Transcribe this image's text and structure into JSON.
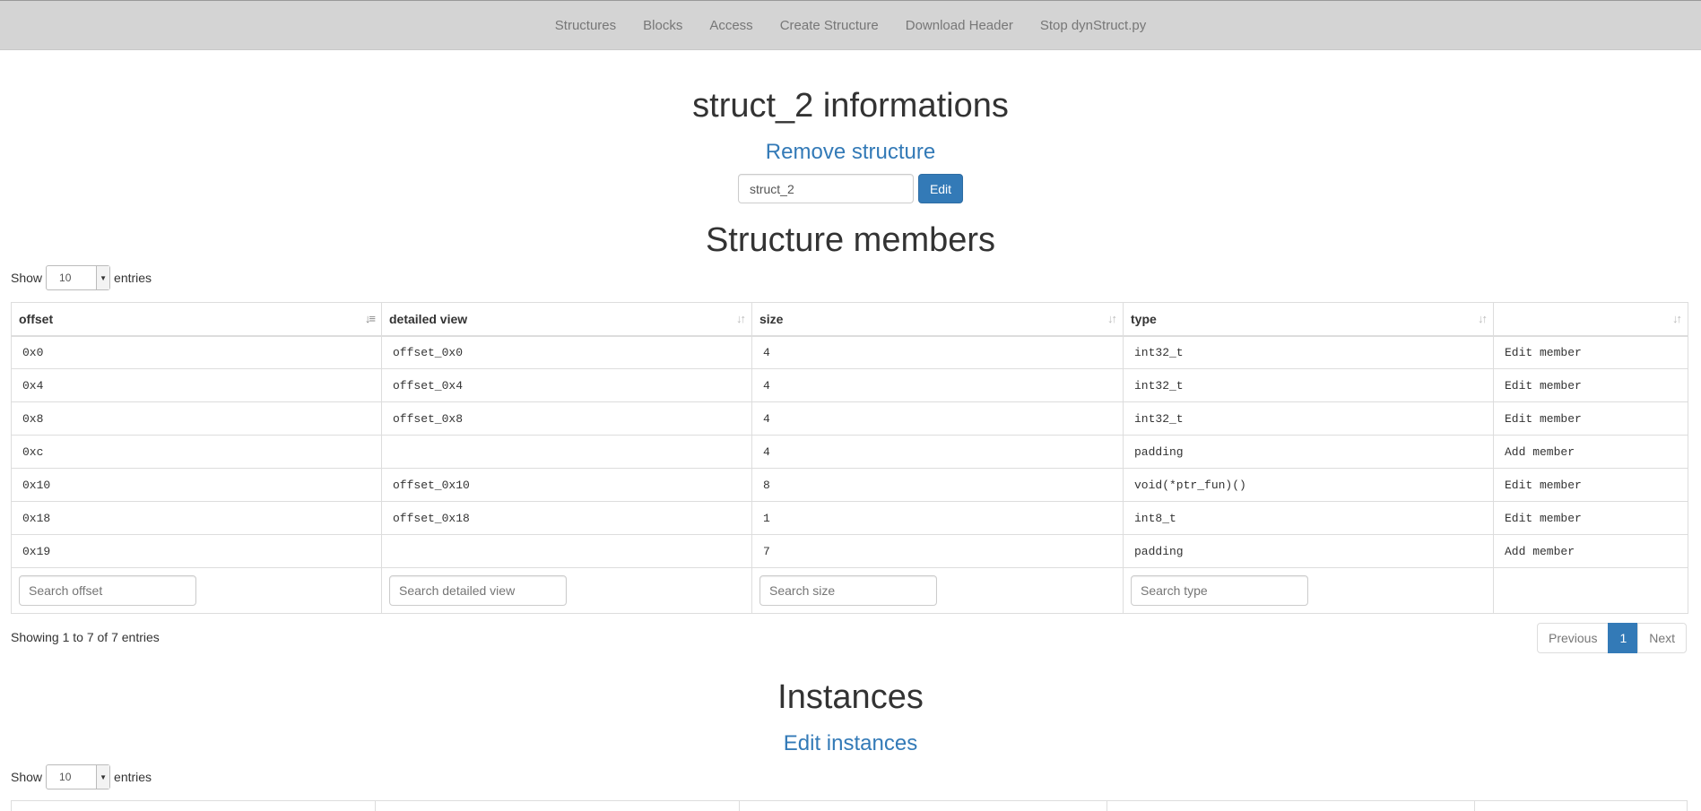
{
  "nav": {
    "items": [
      "Structures",
      "Blocks",
      "Access",
      "Create Structure",
      "Download Header",
      "Stop dynStruct.py"
    ]
  },
  "header": {
    "title": "struct_2 informations",
    "remove_link": "Remove structure",
    "name_value": "struct_2",
    "edit_button": "Edit"
  },
  "members": {
    "title": "Structure members",
    "show_label": "Show",
    "page_size": "10",
    "entries_label": "entries",
    "columns": [
      "offset",
      "detailed view",
      "size",
      "type",
      ""
    ],
    "rows": [
      {
        "offset": "0x0",
        "detail": "offset_0x0",
        "size": "4",
        "type": "int32_t",
        "action": "Edit member"
      },
      {
        "offset": "0x4",
        "detail": "offset_0x4",
        "size": "4",
        "type": "int32_t",
        "action": "Edit member"
      },
      {
        "offset": "0x8",
        "detail": "offset_0x8",
        "size": "4",
        "type": "int32_t",
        "action": "Edit member"
      },
      {
        "offset": "0xc",
        "detail": "",
        "size": "4",
        "type": "padding",
        "action": "Add member"
      },
      {
        "offset": "0x10",
        "detail": "offset_0x10",
        "size": "8",
        "type": "void(*ptr_fun)()",
        "action": "Edit member"
      },
      {
        "offset": "0x18",
        "detail": "offset_0x18",
        "size": "1",
        "type": "int8_t",
        "action": "Edit member"
      },
      {
        "offset": "0x19",
        "detail": "",
        "size": "7",
        "type": "padding",
        "action": "Add member"
      }
    ],
    "filters": {
      "offset": "Search offset",
      "detail": "Search detailed view",
      "size": "Search size",
      "type": "Search type"
    },
    "info": "Showing 1 to 7 of 7 entries",
    "pagination": {
      "previous": "Previous",
      "current": "1",
      "next": "Next"
    }
  },
  "instances": {
    "title": "Instances",
    "edit_link": "Edit instances",
    "show_label": "Show",
    "page_size": "10",
    "entries_label": "entries"
  }
}
